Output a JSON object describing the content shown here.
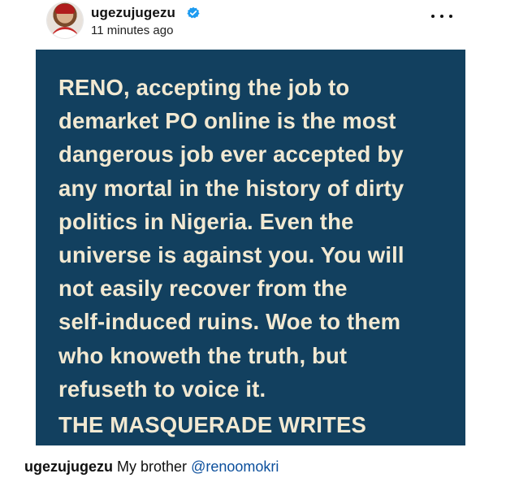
{
  "post": {
    "username": "ugezujugezu",
    "verified_icon": "verified-badge-icon",
    "timestamp": "11 minutes ago",
    "more_icon": "more-options-icon",
    "image_text": "RENO, accepting the job to\ndemarket PO online is the most\ndangerous job ever accepted by\nany mortal in the history of dirty\npolitics in Nigeria. Even the\nuniverse is against you. You will\nnot easily recover from the\nself-induced ruins. Woe to them\nwho knoweth the truth, but\nrefuseth to voice it.",
    "image_signature": "THE MASQUERADE WRITES",
    "caption_username": "ugezujugezu",
    "caption_text": "My brother",
    "caption_mention": "@renoomokri"
  },
  "colors": {
    "image_background": "#12405f",
    "image_text": "#f2e9d2",
    "verified": "#1d9bf0",
    "mention": "#0b4f9c"
  }
}
